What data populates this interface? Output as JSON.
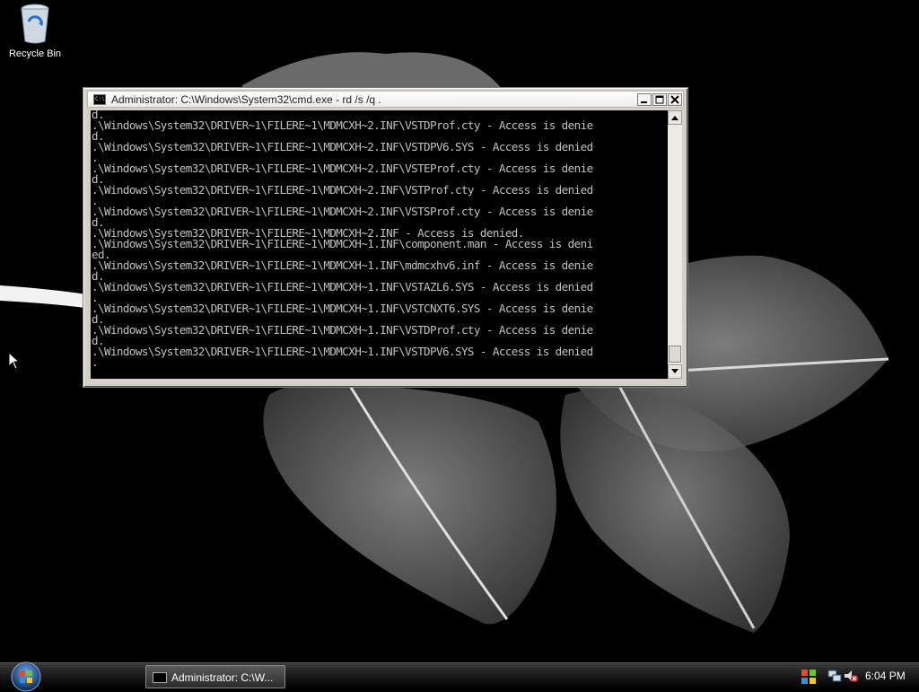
{
  "desktop": {
    "recycle_bin_label": "Recycle Bin"
  },
  "window": {
    "title": "Administrator: C:\\Windows\\System32\\cmd.exe - rd  /s /q ."
  },
  "console": {
    "lines": [
      "d.",
      ".\\Windows\\System32\\DRIVER~1\\FILERE~1\\MDMCXH~2.INF\\VSTDProf.cty - Access is denie",
      "d.",
      ".\\Windows\\System32\\DRIVER~1\\FILERE~1\\MDMCXH~2.INF\\VSTDPV6.SYS - Access is denied",
      ".",
      ".\\Windows\\System32\\DRIVER~1\\FILERE~1\\MDMCXH~2.INF\\VSTEProf.cty - Access is denie",
      "d.",
      ".\\Windows\\System32\\DRIVER~1\\FILERE~1\\MDMCXH~2.INF\\VSTProf.cty - Access is denied",
      ".",
      ".\\Windows\\System32\\DRIVER~1\\FILERE~1\\MDMCXH~2.INF\\VSTSProf.cty - Access is denie",
      "d.",
      ".\\Windows\\System32\\DRIVER~1\\FILERE~1\\MDMCXH~2.INF - Access is denied.",
      ".\\Windows\\System32\\DRIVER~1\\FILERE~1\\MDMCXH~1.INF\\component.man - Access is deni",
      "ed.",
      ".\\Windows\\System32\\DRIVER~1\\FILERE~1\\MDMCXH~1.INF\\mdmcxhv6.inf - Access is denie",
      "d.",
      ".\\Windows\\System32\\DRIVER~1\\FILERE~1\\MDMCXH~1.INF\\VSTAZL6.SYS - Access is denied",
      ".",
      ".\\Windows\\System32\\DRIVER~1\\FILERE~1\\MDMCXH~1.INF\\VSTCNXT6.SYS - Access is denie",
      "d.",
      ".\\Windows\\System32\\DRIVER~1\\FILERE~1\\MDMCXH~1.INF\\VSTDProf.cty - Access is denie",
      "d.",
      ".\\Windows\\System32\\DRIVER~1\\FILERE~1\\MDMCXH~1.INF\\VSTDPV6.SYS - Access is denied",
      "."
    ]
  },
  "taskbar": {
    "task_label": "Administrator: C:\\W...",
    "clock": "6:04 PM"
  }
}
